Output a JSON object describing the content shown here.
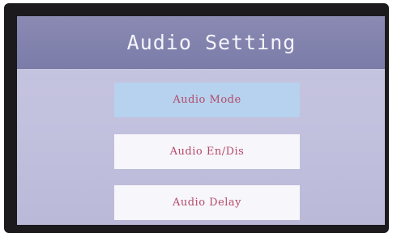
{
  "screen": {
    "title": "Audio Setting"
  },
  "menu": {
    "items": [
      {
        "label": "Audio Mode",
        "state": "selected"
      },
      {
        "label": "Audio En/Dis",
        "state": "normal"
      },
      {
        "label": "Audio Delay",
        "state": "normal"
      }
    ]
  },
  "colors": {
    "title_bar": "#7b7ca8",
    "screen_bg": "#c2c1de",
    "selected_item": "#b6d2ee",
    "normal_item": "#f7f6fa",
    "item_text": "#b44a6a",
    "bezel": "#1c1a1d"
  }
}
